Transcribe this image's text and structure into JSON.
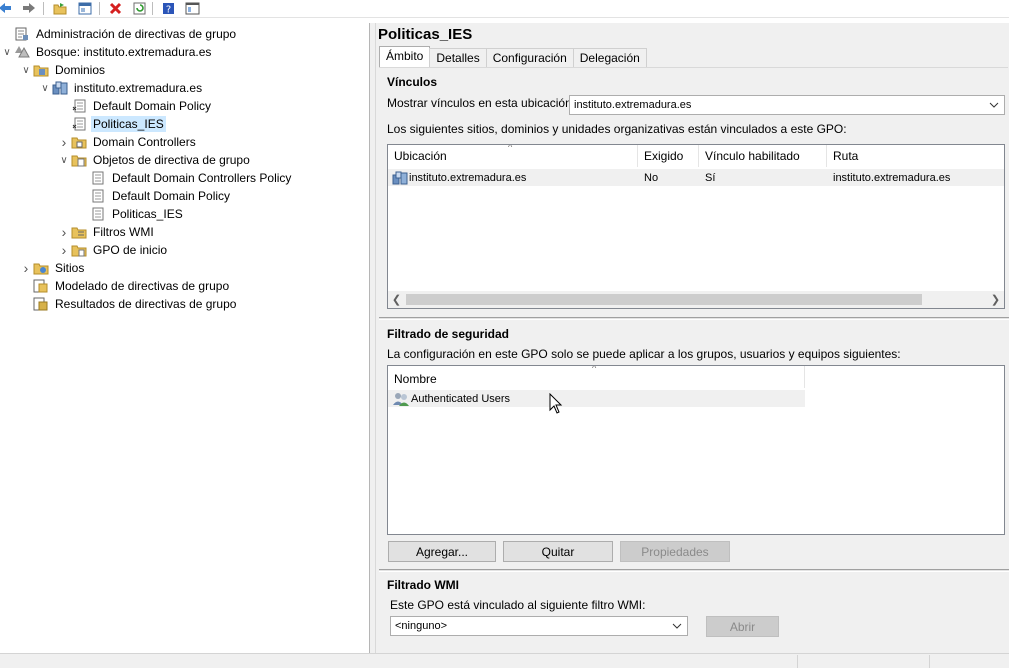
{
  "toolbar": {
    "buttons": [
      "back-icon",
      "forward-icon",
      "open-folder-icon",
      "properties-icon",
      "delete-icon",
      "refresh-icon",
      "help-icon",
      "console-icon"
    ]
  },
  "tree": {
    "items": [
      {
        "label": "Administración de directivas de grupo",
        "icon": "gpmc-icon",
        "expand": ""
      },
      {
        "label": "Bosque: instituto.extremadura.es",
        "icon": "forest-icon",
        "expand": "open"
      },
      {
        "label": "Dominios",
        "icon": "domains-icon",
        "expand": "open"
      },
      {
        "label": "instituto.extremadura.es",
        "icon": "domain-icon",
        "expand": "open"
      },
      {
        "label": "Default Domain Policy",
        "icon": "gpo-link-icon",
        "expand": ""
      },
      {
        "label": "Politicas_IES",
        "icon": "gpo-link-icon",
        "expand": "",
        "selected": true
      },
      {
        "label": "Domain Controllers",
        "icon": "ou-icon",
        "expand": "closed"
      },
      {
        "label": "Objetos de directiva de grupo",
        "icon": "gpo-folder-icon",
        "expand": "open"
      },
      {
        "label": "Default Domain Controllers Policy",
        "icon": "gpo-icon",
        "expand": ""
      },
      {
        "label": "Default Domain Policy",
        "icon": "gpo-icon",
        "expand": ""
      },
      {
        "label": "Politicas_IES",
        "icon": "gpo-icon",
        "expand": ""
      },
      {
        "label": "Filtros WMI",
        "icon": "wmi-folder-icon",
        "expand": "closed"
      },
      {
        "label": "GPO de inicio",
        "icon": "starter-gpo-folder-icon",
        "expand": "closed"
      },
      {
        "label": "Sitios",
        "icon": "sites-icon",
        "expand": "closed"
      },
      {
        "label": "Modelado de directivas de grupo",
        "icon": "modeling-icon",
        "expand": ""
      },
      {
        "label": "Resultados de directivas de grupo",
        "icon": "results-icon",
        "expand": ""
      }
    ]
  },
  "details": {
    "title": "Politicas_IES",
    "tabs": [
      "Ámbito",
      "Detalles",
      "Configuración",
      "Delegación"
    ],
    "links": {
      "heading": "Vínculos",
      "location_label": "Mostrar vínculos en esta ubicación:",
      "location_value": "instituto.extremadura.es",
      "description": "Los siguientes sitios, dominios y unidades organizativas están vinculados a este GPO:",
      "columns": [
        "Ubicación",
        "Exigido",
        "Vínculo habilitado",
        "Ruta"
      ],
      "rows": [
        {
          "location": "instituto.extremadura.es",
          "enforced": "No",
          "enabled": "Sí",
          "path": "instituto.extremadura.es"
        }
      ]
    },
    "security": {
      "heading": "Filtrado de seguridad",
      "description": "La configuración en este GPO solo se puede aplicar a los grupos, usuarios y equipos siguientes:",
      "column": "Nombre",
      "rows": [
        "Authenticated Users"
      ],
      "add_label": "Agregar...",
      "remove_label": "Quitar",
      "properties_label": "Propiedades"
    },
    "wmi": {
      "heading": "Filtrado WMI",
      "description": "Este GPO está vinculado al siguiente filtro WMI:",
      "value": "<ninguno>",
      "open_label": "Abrir"
    }
  }
}
